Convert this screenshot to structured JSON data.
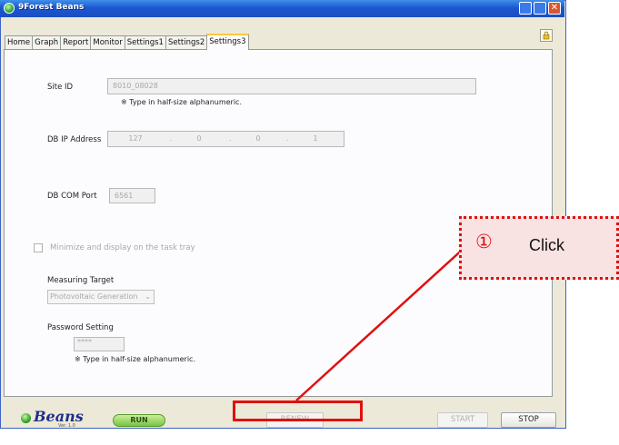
{
  "window": {
    "title": "9Forest Beans",
    "close_glyph": "✕"
  },
  "tabs": [
    {
      "label": "Home"
    },
    {
      "label": "Graph"
    },
    {
      "label": "Report"
    },
    {
      "label": "Monitor"
    },
    {
      "label": "Settings1"
    },
    {
      "label": "Settings2"
    },
    {
      "label": "Settings3",
      "active": true
    }
  ],
  "lock_icon": "lock-icon",
  "settings": {
    "site_id_label": "Site ID",
    "site_id_value": "8010_08028",
    "site_id_note": "※  Type in half-size alphanumeric.",
    "db_ip_label": "DB IP Address",
    "db_ip": [
      "127",
      "0",
      "0",
      "1"
    ],
    "db_ip_sep": ".",
    "db_port_label": "DB COM Port",
    "db_port_value": "6561",
    "tray_checkbox_label": "Minimize and display on the task tray",
    "tray_checked": false,
    "measuring_target_label": "Measuring Target",
    "measuring_target_value": "Photovoltaic Generation",
    "password_label": "Password Setting",
    "password_value": "****",
    "password_note": "※  Type in half-size alphanumeric."
  },
  "bottom": {
    "logo_text": "Beans",
    "logo_version": "Ver. 1.0",
    "run_label": "RUN",
    "renew_label": "RENEW",
    "start_label": "START",
    "stop_label": "STOP"
  },
  "annotation": {
    "number": "①",
    "text": "Click",
    "color": "#e01010"
  }
}
